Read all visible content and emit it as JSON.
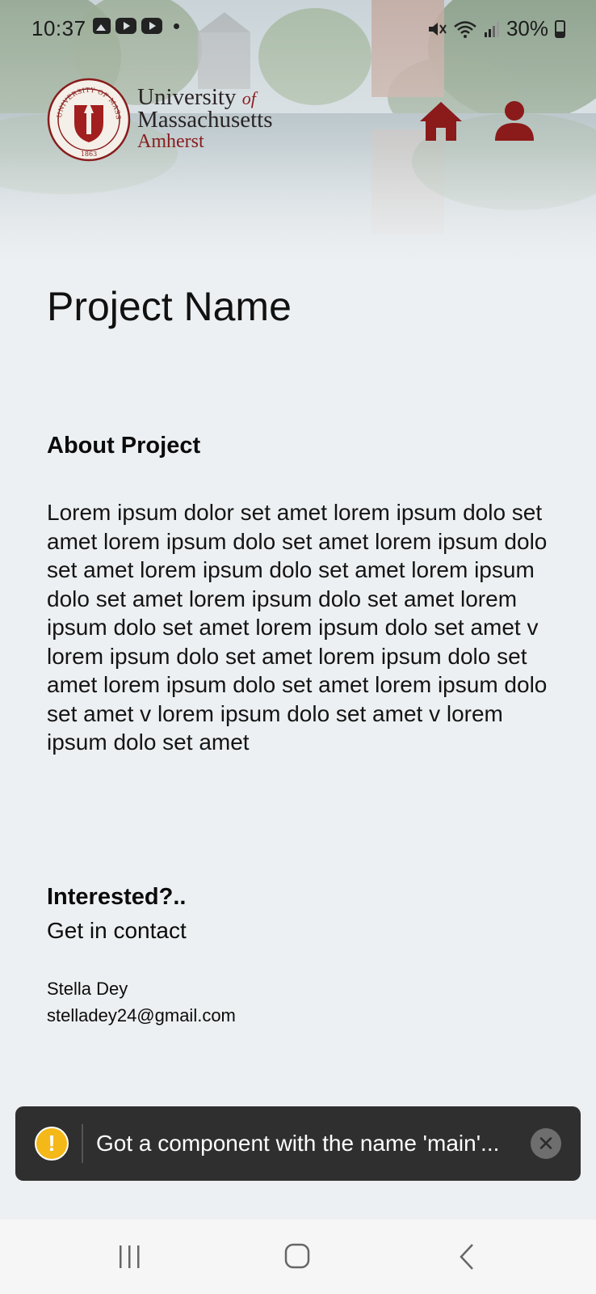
{
  "status_bar": {
    "time": "10:37",
    "battery": "30%",
    "left_icons": [
      "gallery-icon",
      "youtube-icon",
      "youtube-icon",
      "dot-icon"
    ],
    "right_icons": [
      "mute-icon",
      "wifi-icon",
      "signal-icon",
      "battery-icon"
    ]
  },
  "header": {
    "logo": {
      "line1": "University",
      "of": "of",
      "line2": "Massachusetts",
      "line3": "Amherst",
      "seal_text": "UNIVERSITY OF MASSACHUSETTS",
      "seal_year": "1863"
    },
    "nav_icons": [
      "home-icon",
      "user-icon"
    ],
    "accent_color": "#881c1c"
  },
  "project": {
    "title": "Project Name",
    "about_heading": "About Project",
    "about_text": "Lorem ipsum dolor set amet lorem ipsum dolo set amet lorem ipsum dolo set amet lorem ipsum dolo set amet lorem ipsum dolo set amet lorem ipsum dolo set amet lorem ipsum dolo set amet lorem ipsum dolo set amet lorem ipsum dolo set amet v lorem ipsum dolo set amet lorem ipsum dolo set amet lorem ipsum dolo set amet lorem ipsum dolo set amet v lorem ipsum dolo set amet v lorem ipsum dolo set amet"
  },
  "contact": {
    "heading": "Interested?..",
    "subheading": "Get in contact",
    "name": "Stella Dey",
    "email": "stelladey24@gmail.com"
  },
  "toast": {
    "icon": "warning-icon",
    "message": "Got a component with the name 'main'...",
    "close_icon": "close-icon"
  },
  "system_nav": [
    "recent-apps-icon",
    "home-button-icon",
    "back-icon"
  ]
}
